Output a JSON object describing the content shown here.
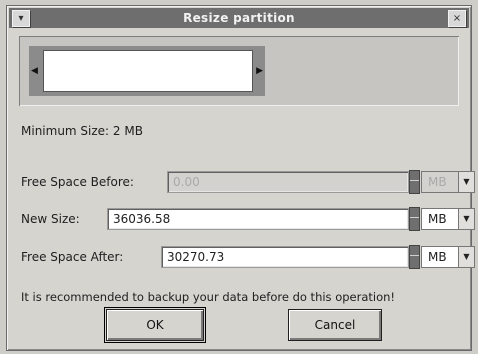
{
  "window": {
    "title": "Resize partition"
  },
  "partition_graph": {},
  "min_size": "Minimum Size: 2 MB",
  "fields": {
    "free_before": {
      "label": "Free Space Before:",
      "value": "0.00",
      "unit": "MB",
      "enabled": false
    },
    "new_size": {
      "label": "New Size:",
      "value": "36036.58",
      "unit": "MB",
      "enabled": true
    },
    "free_after": {
      "label": "Free Space After:",
      "value": "30270.73",
      "unit": "MB",
      "enabled": true
    }
  },
  "notice": "It is recommended to backup your data before do this operation!",
  "buttons": {
    "ok": "OK",
    "cancel": "Cancel"
  },
  "icons": {
    "menu": "window-menu-icon",
    "close": "close-icon",
    "spin": "spin-arrows-icon",
    "dropdown": "chevron-down-icon"
  }
}
